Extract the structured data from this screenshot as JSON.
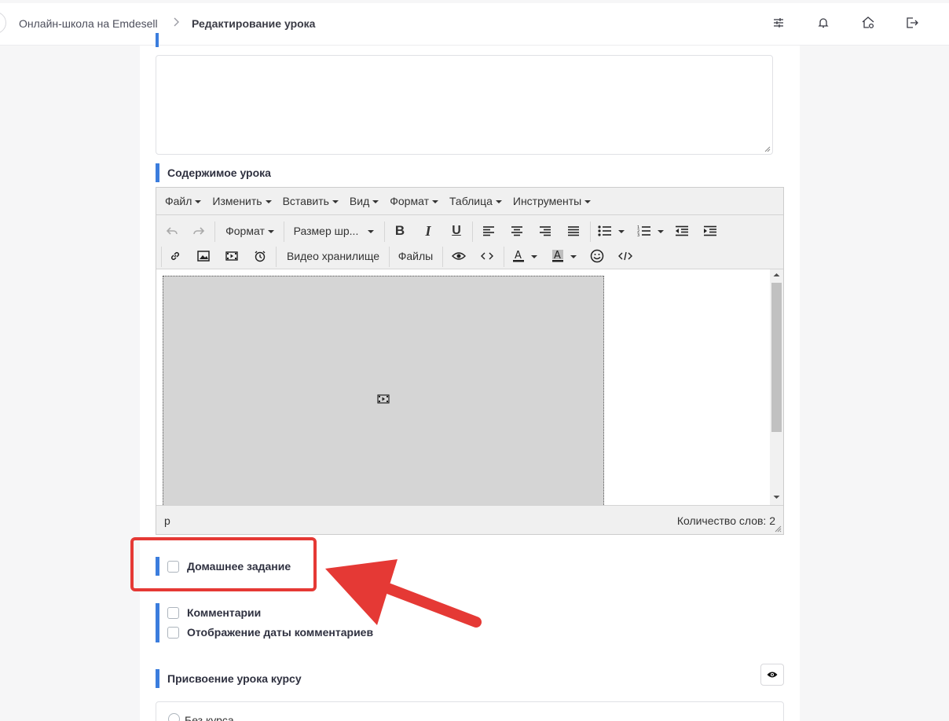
{
  "header": {
    "breadcrumb_home": "Онлайн-школа на Emdesell",
    "breadcrumb_current": "Редактирование урока",
    "icons": [
      "sliders-icon",
      "bell-icon",
      "home-settings-icon",
      "logout-icon"
    ]
  },
  "form": {
    "content_label": "Содержимое урока",
    "homework_label": "Домашнее задание",
    "comments_label": "Комментарии",
    "comments_date_label": "Отображение даты комментариев",
    "course_assign_label": "Присвоение урока курсу",
    "no_course_label": "Без курса"
  },
  "editor": {
    "menu": [
      "Файл",
      "Изменить",
      "Вставить",
      "Вид",
      "Формат",
      "Таблица",
      "Инструменты"
    ],
    "format_select": "Формат",
    "font_size_select": "Размер шр...",
    "video_storage_button": "Видео хранилище",
    "files_button": "Файлы",
    "status_path": "p",
    "word_count": "Количество слов: 2"
  },
  "colors": {
    "accent": "#3b7ddd",
    "annotation": "#e53935"
  }
}
